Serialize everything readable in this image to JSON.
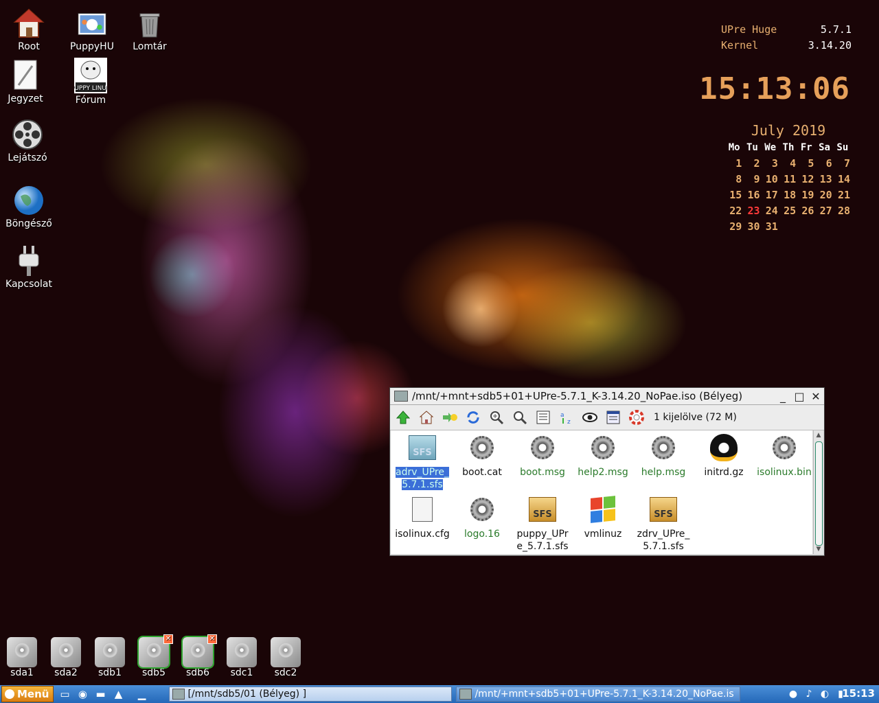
{
  "desktop_icons": [
    {
      "label": "Root",
      "icon": "home-icon"
    },
    {
      "label": "PuppyHU",
      "icon": "puppyhu-icon"
    },
    {
      "label": "Lomtár",
      "icon": "trash-icon"
    },
    {
      "label": "Jegyzet",
      "icon": "notepad-icon"
    },
    {
      "label": "Fórum",
      "icon": "forum-icon"
    },
    {
      "label": "Lejátszó",
      "icon": "film-reel-icon"
    },
    {
      "label": "Böngésző",
      "icon": "globe-icon"
    },
    {
      "label": "Kapcsolat",
      "icon": "plug-icon"
    }
  ],
  "forum_logo_text": "PUPPY LINUX",
  "drives": [
    "sda1",
    "sda2",
    "sdb1",
    "sdb5",
    "sdb6",
    "sdc1",
    "sdc2"
  ],
  "drive_badge": "✕",
  "conky": {
    "rows": [
      {
        "label": "UPre Huge",
        "value": "5.7.1"
      },
      {
        "label": "Kernel",
        "value": "3.14.20"
      }
    ],
    "clock": "15:13:06"
  },
  "calendar": {
    "title": "July  2019",
    "weekdays": [
      "Mo",
      "Tu",
      "We",
      "Th",
      "Fr",
      "Sa",
      "Su"
    ],
    "weeks": [
      [
        "1",
        "2",
        "3",
        "4",
        "5",
        "6",
        "7"
      ],
      [
        "8",
        "9",
        "10",
        "11",
        "12",
        "13",
        "14"
      ],
      [
        "15",
        "16",
        "17",
        "18",
        "19",
        "20",
        "21"
      ],
      [
        "22",
        "23",
        "24",
        "25",
        "26",
        "27",
        "28"
      ],
      [
        "29",
        "30",
        "31",
        "",
        "",
        "",
        ""
      ]
    ],
    "today": "23",
    "today_color": "#ff3a3a"
  },
  "window": {
    "title": "/mnt/+mnt+sdb5+01+UPre-5.7.1_K-3.14.20_NoPae.iso (Bélyeg)",
    "minimize": "_",
    "maximize": "□",
    "close": "✕",
    "status": "1 kijelölve (72 M)",
    "toolbar_icons": [
      "up-arrow-icon",
      "home-icon",
      "bookmark-icon",
      "refresh-icon",
      "zoom-in-icon",
      "zoom-fit-icon",
      "details-icon",
      "sort-icon",
      "eye-icon",
      "list-icon",
      "help-icon"
    ],
    "files": [
      {
        "name": "adrv_UPre_\n5.7.1.sfs",
        "icon": "sfs-blue-icon",
        "selected": true
      },
      {
        "name": "boot.cat",
        "icon": "gear-icon"
      },
      {
        "name": "boot.msg",
        "icon": "gear-icon"
      },
      {
        "name": "help2.msg",
        "icon": "gear-icon"
      },
      {
        "name": "help.msg",
        "icon": "gear-icon"
      },
      {
        "name": "initrd.gz",
        "icon": "penguin-icon"
      },
      {
        "name": "isolinux.bin",
        "icon": "gear-icon"
      },
      {
        "name": "isolinux.cfg",
        "icon": "document-icon"
      },
      {
        "name": "logo.16",
        "icon": "gear-icon"
      },
      {
        "name": "puppy_UPr\ne_5.7.1.sfs",
        "icon": "sfs-icon"
      },
      {
        "name": "vmlinuz",
        "icon": "windows-logo-icon"
      },
      {
        "name": "zdrv_UPre_\n5.7.1.sfs",
        "icon": "sfs-icon"
      }
    ],
    "sfs_label": "SFS"
  },
  "taskbar": {
    "menu_label": "Menü",
    "tasks": [
      "[/mnt/sdb5/01 (Bélyeg) ]",
      "/mnt/+mnt+sdb5+01+UPre-5.7.1_K-3.14.20_NoPae.is"
    ],
    "clock": "15:13"
  }
}
